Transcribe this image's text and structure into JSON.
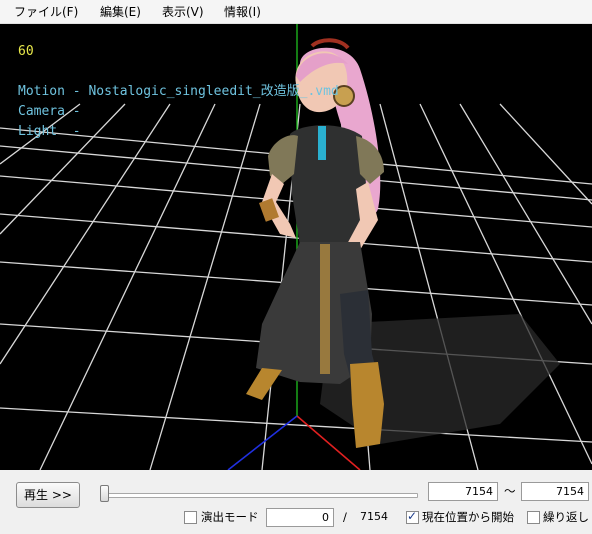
{
  "menu": [
    {
      "label": "ファイル(F)"
    },
    {
      "label": "編集(E)"
    },
    {
      "label": "表示(V)"
    },
    {
      "label": "情報(I)"
    }
  ],
  "viewport": {
    "fps": "60",
    "motion_line": "Motion - Nostalogic_singleedit_改造版_.vmd",
    "camera_line": "Camera -",
    "light_line": "Light  -"
  },
  "controls": {
    "play_button": "再生 >>",
    "timeline_position": 0.0,
    "range_start": "7154",
    "range_tilde": "〜",
    "range_end": "7154",
    "staging_mode_label": "演出モード",
    "staging_mode_checked": false,
    "current_frame": "0",
    "frame_separator": "/",
    "total_frames": "7154",
    "start_from_current_label": "現在位置から開始",
    "start_from_current_checked": true,
    "loop_label": "繰り返し",
    "loop_checked": false
  },
  "colors": {
    "viewport_bg": "#000000",
    "grid": "#d8d8d8",
    "axis_x": "#e02020",
    "axis_y": "#20c020",
    "axis_z": "#2030e0",
    "fps_text": "#e8e84a",
    "info_text": "#6fc3df"
  }
}
